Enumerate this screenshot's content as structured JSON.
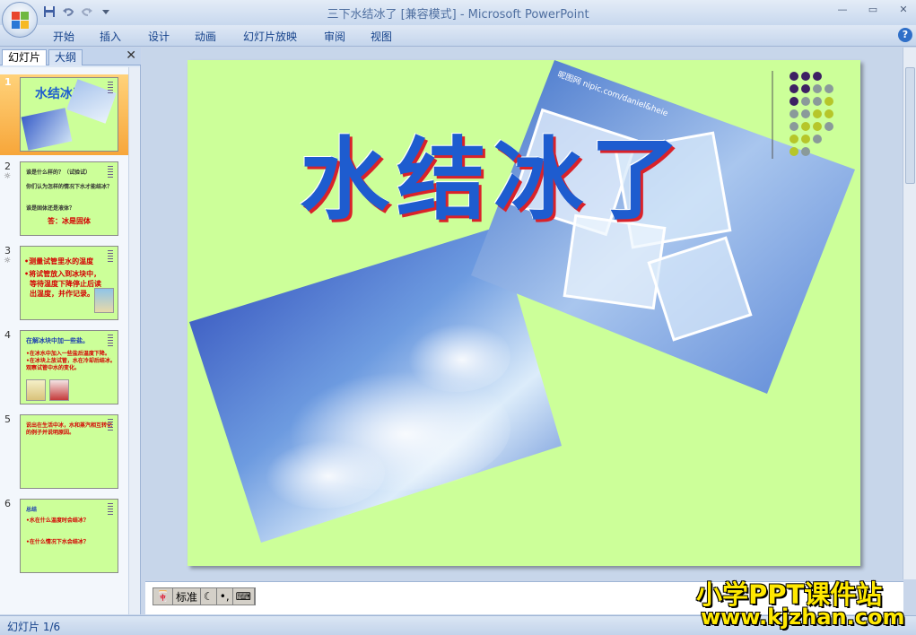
{
  "window": {
    "title": "三下水结冰了 [兼容模式] - Microsoft PowerPoint",
    "controls": [
      "—",
      "▭",
      "✕"
    ]
  },
  "ribbon": {
    "tabs": [
      "开始",
      "插入",
      "设计",
      "动画",
      "幻灯片放映",
      "审阅",
      "视图"
    ],
    "help": "?"
  },
  "left_pane": {
    "tabs": [
      "幻灯片",
      "大纲"
    ],
    "close": "✕",
    "slides": [
      {
        "num": "1",
        "anim": "",
        "lines": [
          {
            "text": "水结冰了",
            "color": "#1e5ccf"
          }
        ]
      },
      {
        "num": "2",
        "anim": "☼",
        "lines": [
          {
            "text": "谁是什么样的？（试验试）",
            "color": "#333333"
          },
          {
            "text": "你们认为怎样的情况下水才能结冰？",
            "color": "#333333"
          },
          {
            "text": "谁是固体还是液体？",
            "color": "#333333"
          },
          {
            "text": "答：冰是固体",
            "color": "#d40000"
          }
        ]
      },
      {
        "num": "3",
        "anim": "☼",
        "lines": [
          {
            "text": "•测量试管里水的温度",
            "color": "#d40000"
          },
          {
            "text": "•将试管放入到冰块中，",
            "color": "#d40000"
          },
          {
            "text": "等待温度下降停止后读",
            "color": "#d40000"
          },
          {
            "text": "出温度，并作记录。",
            "color": "#d40000"
          }
        ]
      },
      {
        "num": "4",
        "anim": "",
        "lines": [
          {
            "text": "在解冰块中加一些盐。",
            "color": "#1e40b0"
          },
          {
            "text": "•在冰水中加入一些盐后温度下降。",
            "color": "#d40000"
          },
          {
            "text": "•在冰块上放试管，水在冷却后结冰。",
            "color": "#d40000"
          },
          {
            "text": "观察试管中水的变化。",
            "color": "#d40000"
          }
        ]
      },
      {
        "num": "5",
        "anim": "",
        "lines": [
          {
            "text": "说出在生活中冰，水和蒸汽相互转化",
            "color": "#d40000"
          },
          {
            "text": "的例子并说明原因。",
            "color": "#d40000"
          }
        ]
      },
      {
        "num": "6",
        "anim": "",
        "lines": [
          {
            "text": "总结",
            "color": "#1e40b0"
          },
          {
            "text": "•水在什么温度时会结冰？",
            "color": "#d40000"
          },
          {
            "text": "•在什么情况下水会结冰？",
            "color": "#d40000"
          }
        ]
      }
    ]
  },
  "slide": {
    "title": "水结冰了",
    "photo_watermark": "昵图网 nipic.com/daniel&heie"
  },
  "ime": {
    "mode": "标准",
    "items": [
      "🀄",
      "☾",
      "•,",
      "⌨"
    ]
  },
  "status": {
    "text": "幻灯片 1/6"
  },
  "watermark": {
    "name": "小学PPT课件站",
    "url": "www.kjzhan.com"
  },
  "colors": {
    "slide_bg": "#ccff99",
    "title_fill": "#1e5ccf",
    "title_shadow": "#d9222a",
    "watermark": "#ffe800"
  }
}
